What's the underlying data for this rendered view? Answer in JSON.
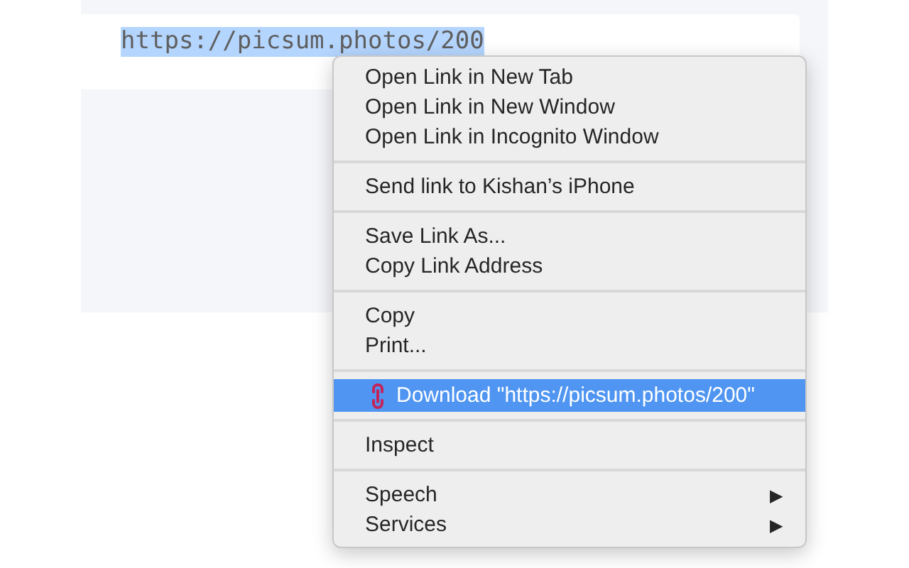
{
  "page": {
    "url_text": "https://picsum.photos/200",
    "url_selected": true
  },
  "context_menu": {
    "groups": [
      {
        "items": [
          {
            "label": "Open Link in New Tab",
            "selected": false
          },
          {
            "label": "Open Link in New Window",
            "selected": false
          },
          {
            "label": "Open Link in Incognito Window",
            "selected": false
          }
        ]
      },
      {
        "items": [
          {
            "label": "Send link to Kishan’s iPhone",
            "selected": false
          }
        ]
      },
      {
        "items": [
          {
            "label": "Save Link As...",
            "selected": false
          },
          {
            "label": "Copy Link Address",
            "selected": false
          }
        ]
      },
      {
        "items": [
          {
            "label": "Copy",
            "selected": false
          },
          {
            "label": "Print...",
            "selected": false
          }
        ]
      },
      {
        "items": [
          {
            "label": "Download \"https://picsum.photos/200\"",
            "selected": true,
            "kind": "download"
          }
        ]
      },
      {
        "items": [
          {
            "label": "Inspect",
            "selected": false
          }
        ]
      },
      {
        "items": [
          {
            "label": "Speech",
            "selected": false,
            "submenu": "▶"
          },
          {
            "label": "Services",
            "selected": false,
            "submenu": "▶"
          }
        ]
      }
    ]
  }
}
